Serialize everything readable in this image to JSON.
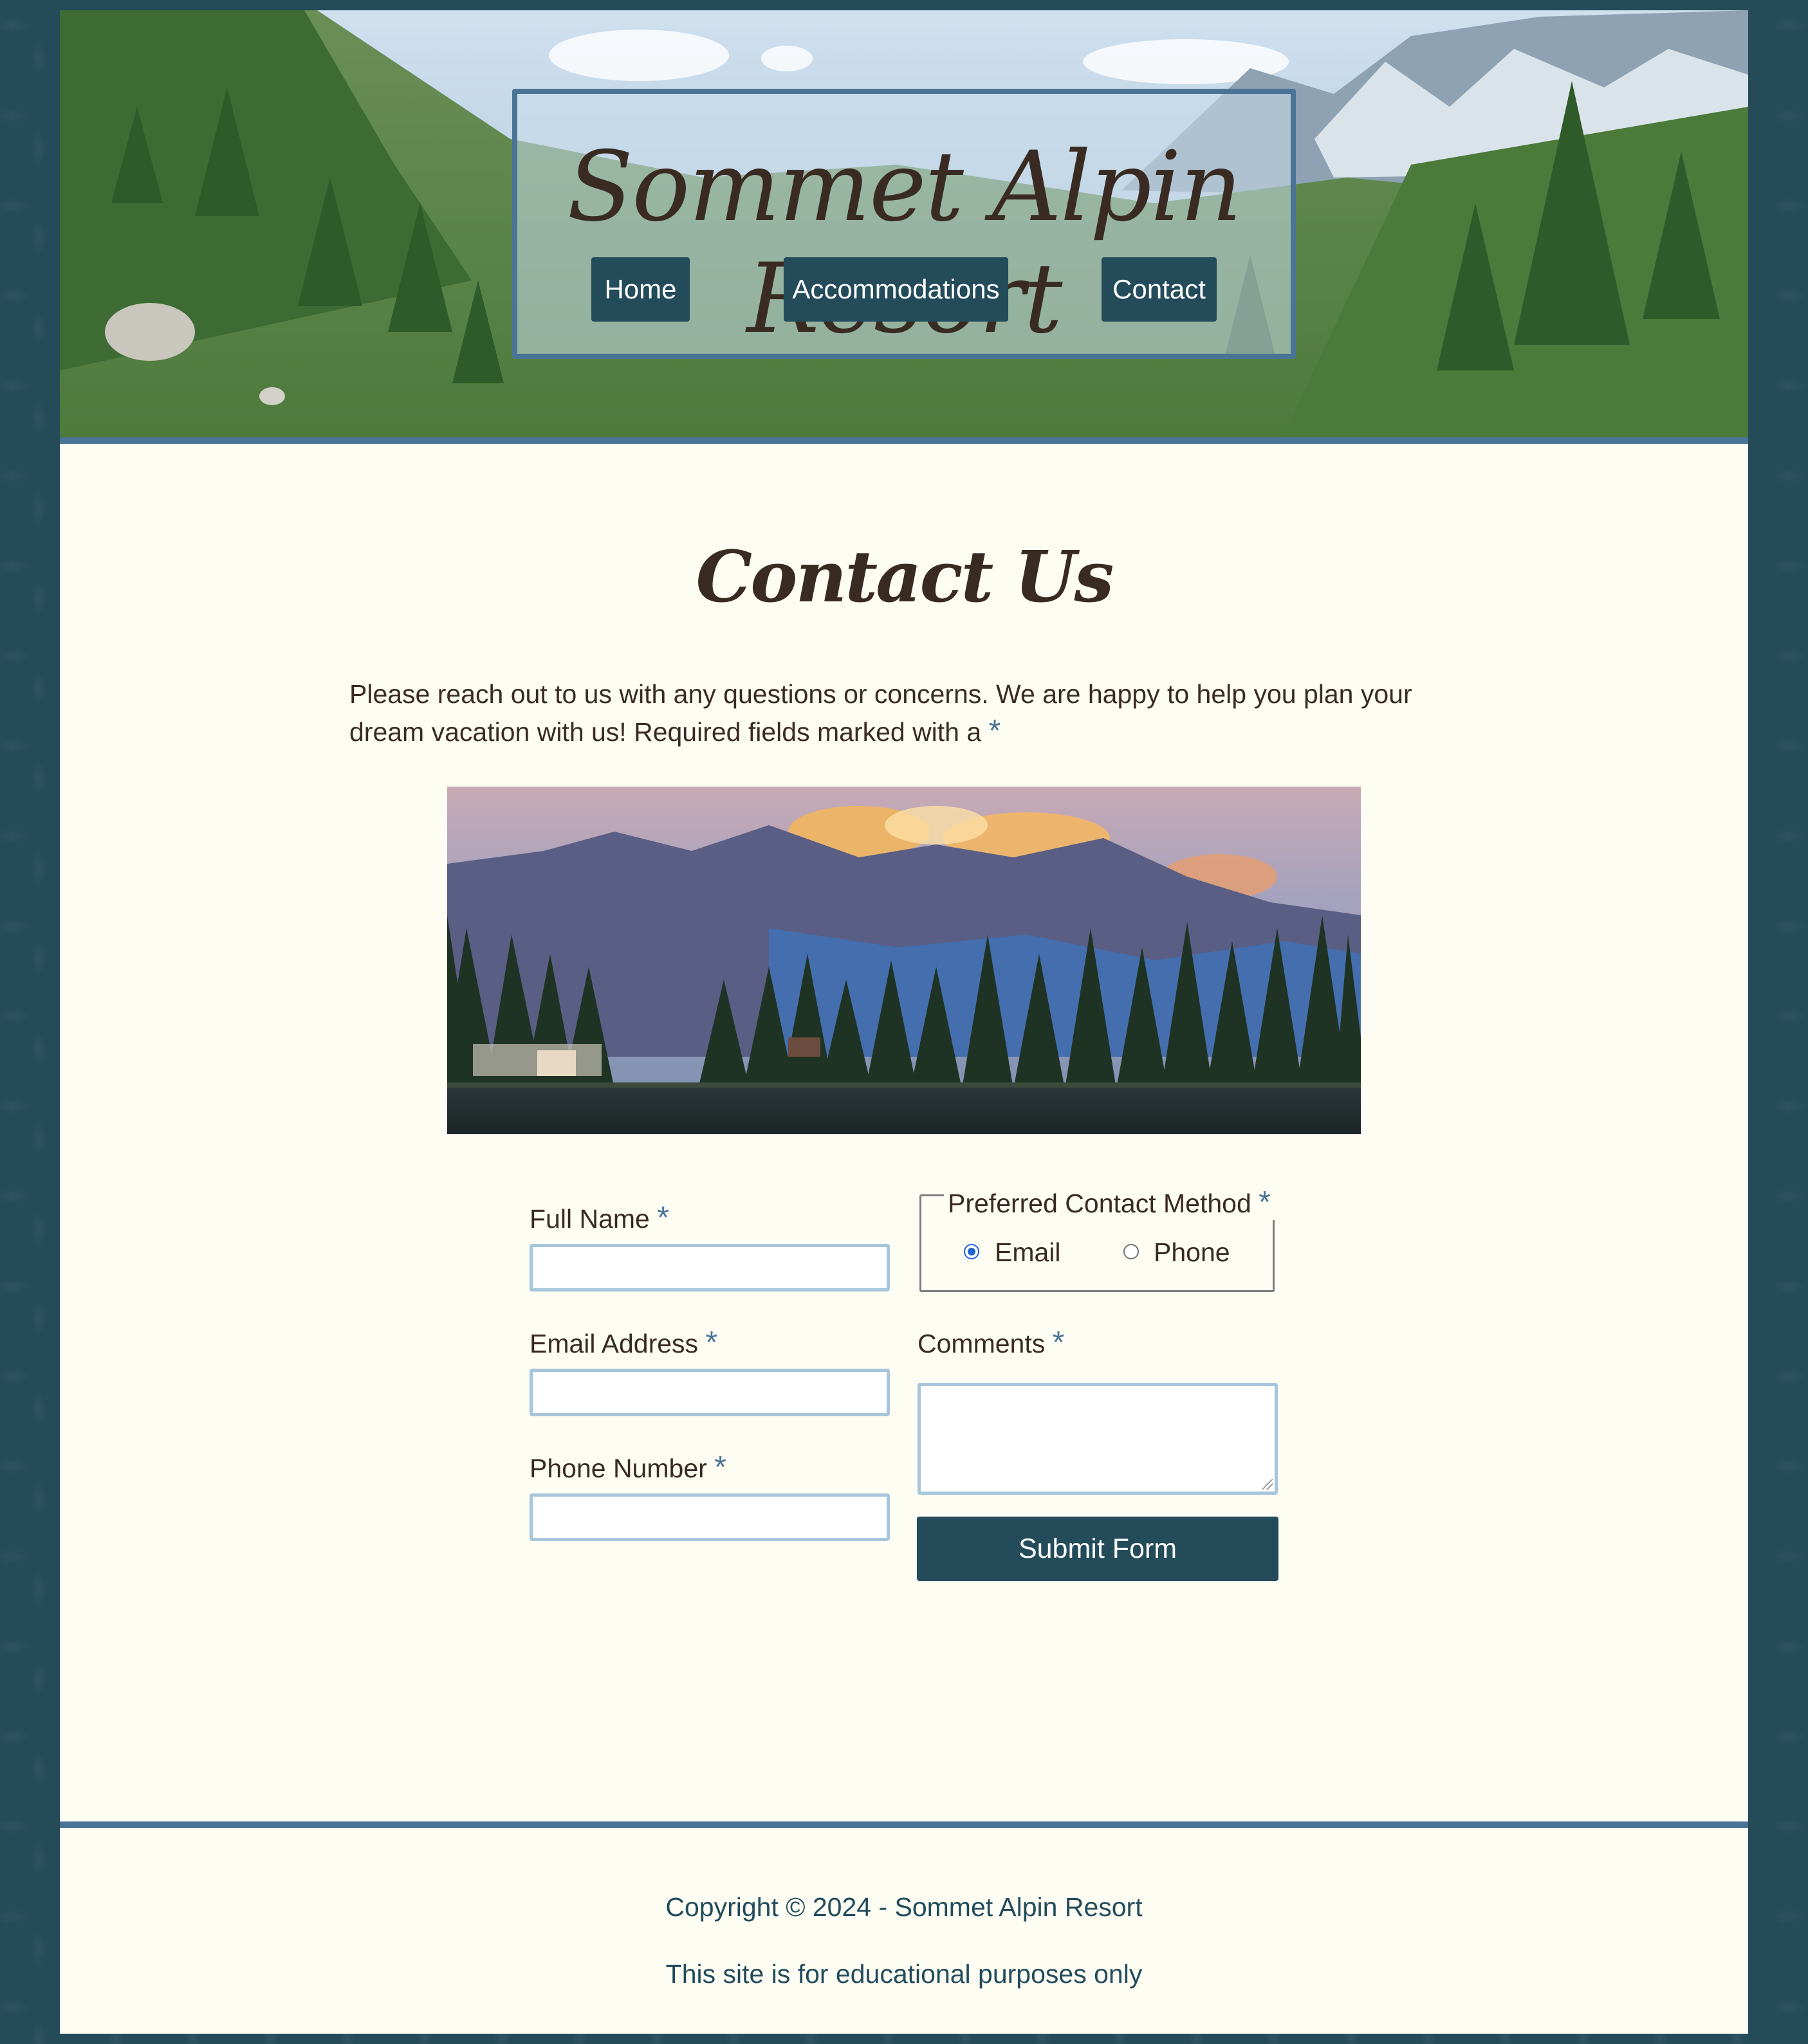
{
  "site": {
    "title": "Sommet Alpin Resort"
  },
  "nav": {
    "items": [
      {
        "label": "Home"
      },
      {
        "label": "Accommodations"
      },
      {
        "label": "Contact"
      }
    ]
  },
  "main": {
    "heading": "Contact Us",
    "intro": "Please reach out to us with any questions or concerns. We are happy to help you plan your dream vacation with us! Required fields marked with a",
    "required_marker": "*"
  },
  "form": {
    "full_name": {
      "label": "Full Name",
      "value": ""
    },
    "email": {
      "label": "Email Address",
      "value": ""
    },
    "phone": {
      "label": "Phone Number",
      "value": ""
    },
    "contact_method": {
      "legend": "Preferred Contact Method",
      "options": [
        {
          "label": "Email",
          "checked": true
        },
        {
          "label": "Phone",
          "checked": false
        }
      ]
    },
    "comments": {
      "label": "Comments",
      "value": ""
    },
    "submit_label": "Submit Form"
  },
  "footer": {
    "copyright": "Copyright © 2024 - Sommet Alpin Resort",
    "disclaimer": "This site is for educational purposes only"
  },
  "colors": {
    "background": "#254a58",
    "page": "#fdfdf4",
    "accent_border": "#4a7496",
    "button": "#234b5a",
    "input_border": "#a7c5db",
    "text": "#3a2b22"
  }
}
